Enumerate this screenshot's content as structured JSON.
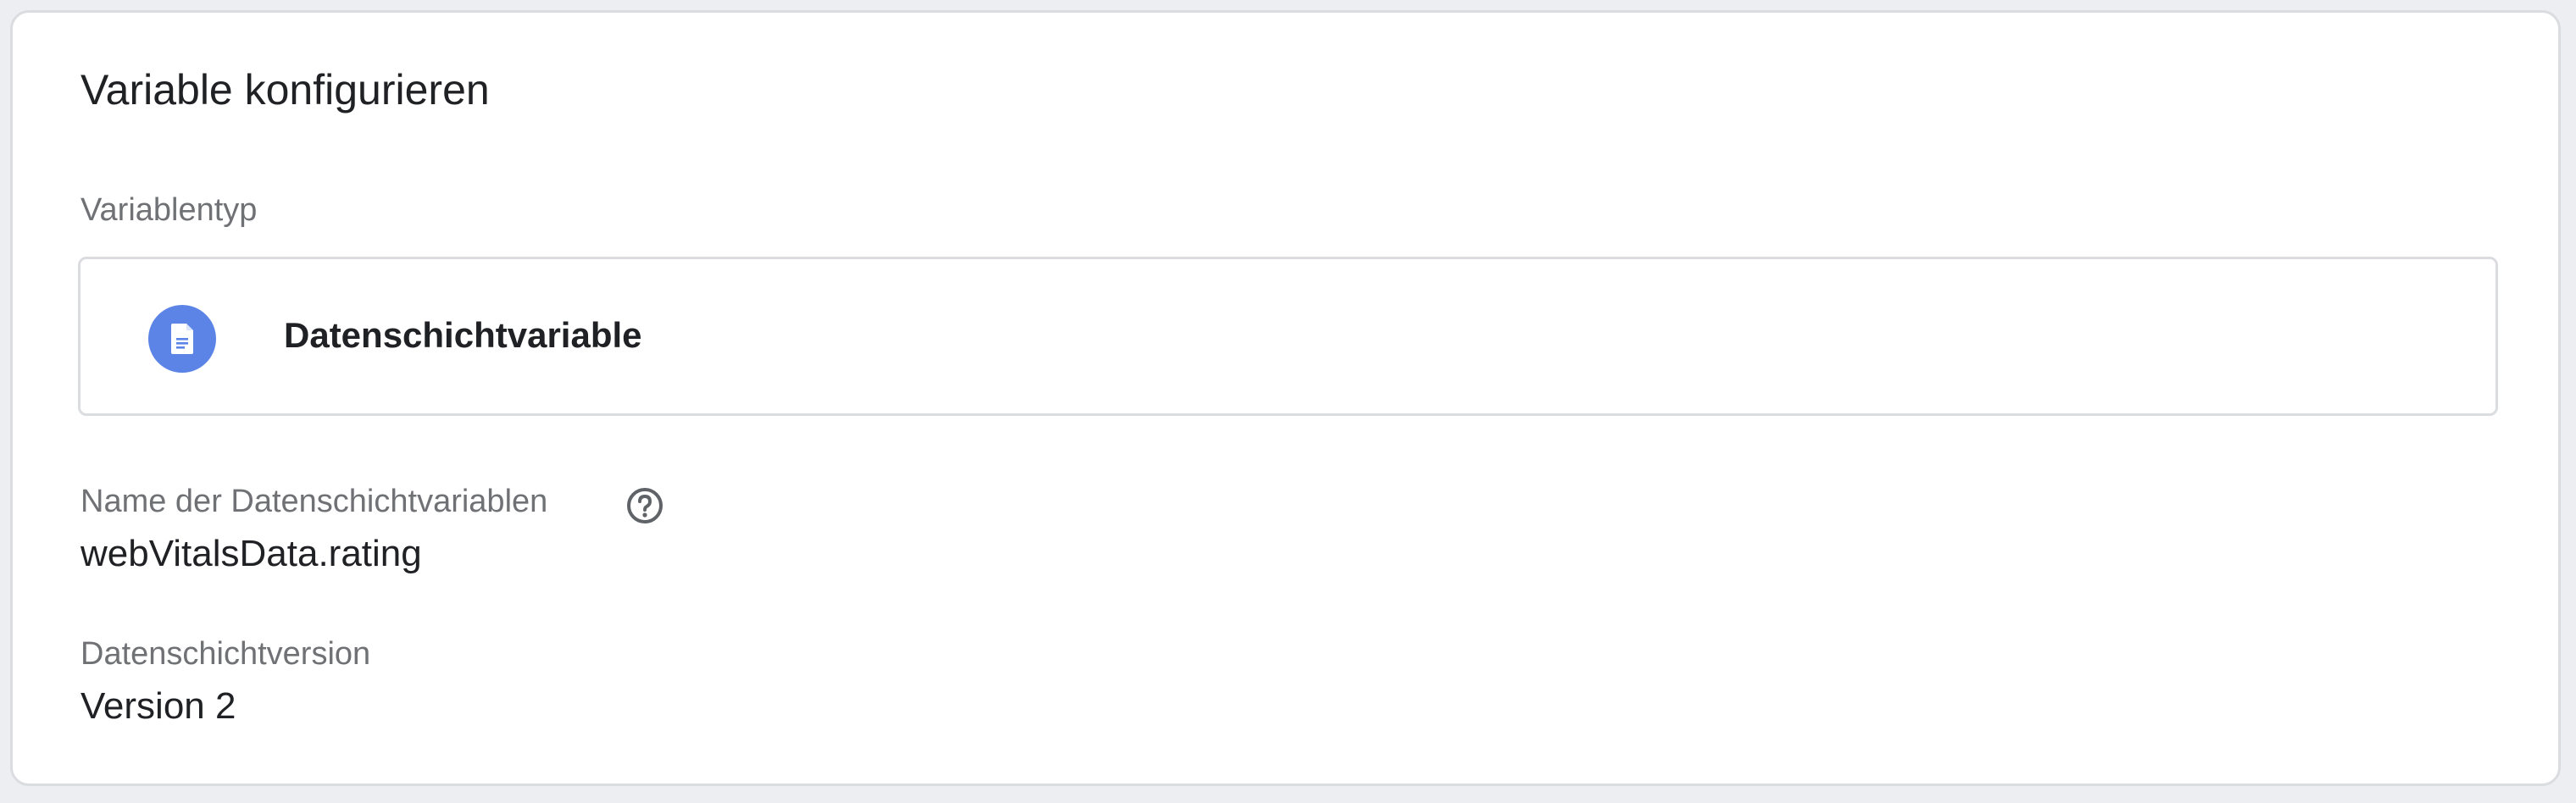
{
  "card": {
    "title": "Variable konfigurieren"
  },
  "variable_type": {
    "label": "Variablentyp",
    "value": "Datenschichtvariable",
    "icon": "document-icon",
    "icon_color": "#5b84e6"
  },
  "variable_name": {
    "label": "Name der Datenschichtvariablen",
    "help_icon": "help-circle-icon",
    "value": "webVitalsData.rating"
  },
  "data_layer_version": {
    "label": "Datenschichtversion",
    "value": "Version 2"
  }
}
